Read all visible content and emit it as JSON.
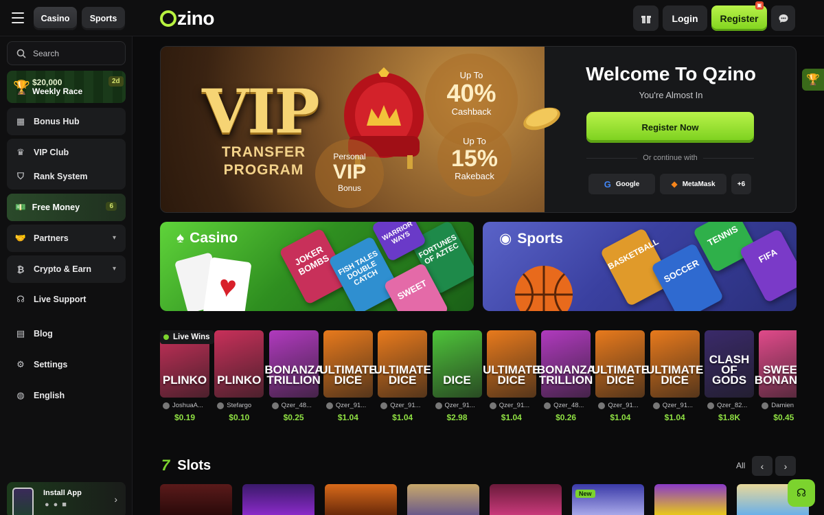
{
  "topbar": {
    "tabs": [
      {
        "label": "Casino"
      },
      {
        "label": "Sports"
      }
    ],
    "logo": "Qzino",
    "login": "Login",
    "register": "Register"
  },
  "sidebar": {
    "search_placeholder": "Search",
    "race": {
      "amount": "$20,000",
      "label": "Weekly Race",
      "days": "2d"
    },
    "items": [
      {
        "label": "Bonus Hub",
        "icon": "gift-box-icon"
      },
      {
        "label": "VIP Club",
        "icon": "crown-icon"
      },
      {
        "label": "Rank System",
        "icon": "shield-rank-icon"
      },
      {
        "label": "Free Money",
        "icon": "cash-icon",
        "count": "6"
      },
      {
        "label": "Partners",
        "icon": "handshake-icon"
      },
      {
        "label": "Crypto & Earn",
        "icon": "crypto-icon"
      },
      {
        "label": "Live Support",
        "icon": "headset-icon"
      },
      {
        "label": "Blog",
        "icon": "blog-icon"
      },
      {
        "label": "Settings",
        "icon": "gear-icon"
      },
      {
        "label": "English",
        "icon": "globe-icon"
      }
    ],
    "install": {
      "label": "Install App"
    }
  },
  "hero": {
    "vip_title": "VIP",
    "vip_sub1": "TRANSFER",
    "vip_sub2": "PROGRAM",
    "cashback": {
      "up_to": "Up To",
      "value": "40%",
      "label": "Cashback"
    },
    "rakeback": {
      "up_to": "Up To",
      "value": "15%",
      "label": "Rakeback"
    },
    "personal": {
      "top": "Personal",
      "value": "VIP",
      "label": "Bonus"
    },
    "welcome_title": "Welcome To Qzino",
    "welcome_sub": "You're Almost In",
    "register_now": "Register Now",
    "or_continue": "Or continue with",
    "google": "Google",
    "metamask": "MetaMask",
    "more": "+6"
  },
  "categories": {
    "casino": {
      "label": "Casino",
      "tiles": [
        "JOKER BOMBS",
        "FISH TALES DOUBLE CATCH",
        "FORTUNES OF AZTEC",
        "WARRIOR WAYS",
        "SWEET"
      ]
    },
    "sports": {
      "label": "Sports",
      "tiles": [
        "BASKETBALL",
        "SOCCER",
        "TENNIS",
        "FIFA"
      ]
    }
  },
  "live_wins": {
    "label": "Live Wins",
    "items": [
      {
        "game": "PLINKO",
        "user": "JoshuaA...",
        "amount": "$0.19",
        "color": "#c8305a"
      },
      {
        "game": "PLINKO",
        "user": "Stefargo",
        "amount": "$0.10",
        "color": "#c8305a"
      },
      {
        "game": "BONANZA TRILLION",
        "user": "Qzer_48...",
        "amount": "$0.25",
        "color": "#b03abe"
      },
      {
        "game": "ULTIMATE DICE",
        "user": "Qzer_91...",
        "amount": "$1.04",
        "color": "#e87a1c"
      },
      {
        "game": "ULTIMATE DICE",
        "user": "Qzer_91...",
        "amount": "$1.04",
        "color": "#e87a1c"
      },
      {
        "game": "DICE",
        "user": "Qzer_91...",
        "amount": "$2.98",
        "color": "#4ec43a"
      },
      {
        "game": "ULTIMATE DICE",
        "user": "Qzer_91...",
        "amount": "$1.04",
        "color": "#e87a1c"
      },
      {
        "game": "BONANZA TRILLION",
        "user": "Qzer_48...",
        "amount": "$0.26",
        "color": "#b03abe"
      },
      {
        "game": "ULTIMATE DICE",
        "user": "Qzer_91...",
        "amount": "$1.04",
        "color": "#e87a1c"
      },
      {
        "game": "ULTIMATE DICE",
        "user": "Qzer_91...",
        "amount": "$1.04",
        "color": "#e87a1c"
      },
      {
        "game": "CLASH OF GODS",
        "user": "Qzer_82...",
        "amount": "$1.8K",
        "color": "#3a2a6a"
      },
      {
        "game": "SWEET BONANZA",
        "user": "Damien",
        "amount": "$0.45",
        "color": "#e04a8a"
      }
    ]
  },
  "slots": {
    "title": "Slots",
    "all": "All",
    "new_badge": "New"
  },
  "colors": {
    "accent": "#7cd32e",
    "bg": "#0b0b0c",
    "panel": "#1b1c1e"
  }
}
